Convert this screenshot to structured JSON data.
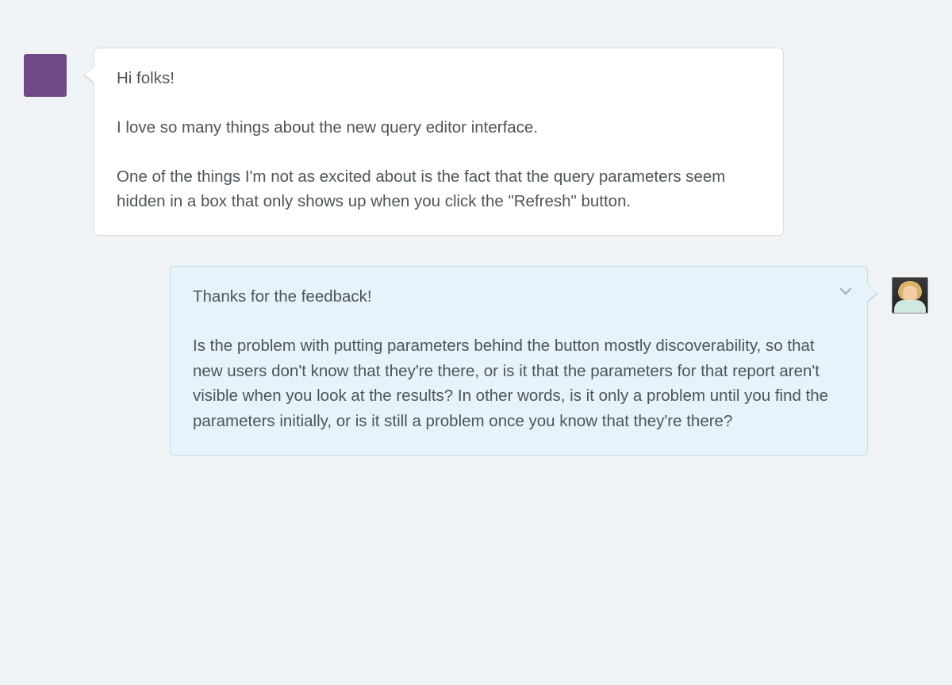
{
  "colors": {
    "page_bg": "#f0f3f5",
    "incoming_bg": "#ffffff",
    "incoming_border": "#d7dde2",
    "outgoing_bg": "#e6f3fb",
    "outgoing_border": "#c9dbe6",
    "text": "#4c555a",
    "avatar_incoming": "#6f4a87"
  },
  "thread": {
    "messages": [
      {
        "side": "left",
        "avatar": {
          "kind": "solid-color",
          "color": "#6f4a87"
        },
        "paragraphs": [
          "Hi folks!",
          "I love so many things about the new query editor interface.",
          "One of the things I'm not as excited about is the fact that the query parameters seem hidden in a box that only shows up when you click the \"Refresh\" button."
        ]
      },
      {
        "side": "right",
        "avatar": {
          "kind": "photo"
        },
        "has_dropdown": true,
        "paragraphs": [
          "Thanks for the feedback!",
          "Is the problem with putting parameters behind the button mostly discoverability, so that new users don't know that they're there, or is it that the parameters for that report aren't visible when you look at the results? In other words, is it only a problem until you find the parameters initially, or is it still a problem once you know that they're there?"
        ]
      }
    ]
  }
}
